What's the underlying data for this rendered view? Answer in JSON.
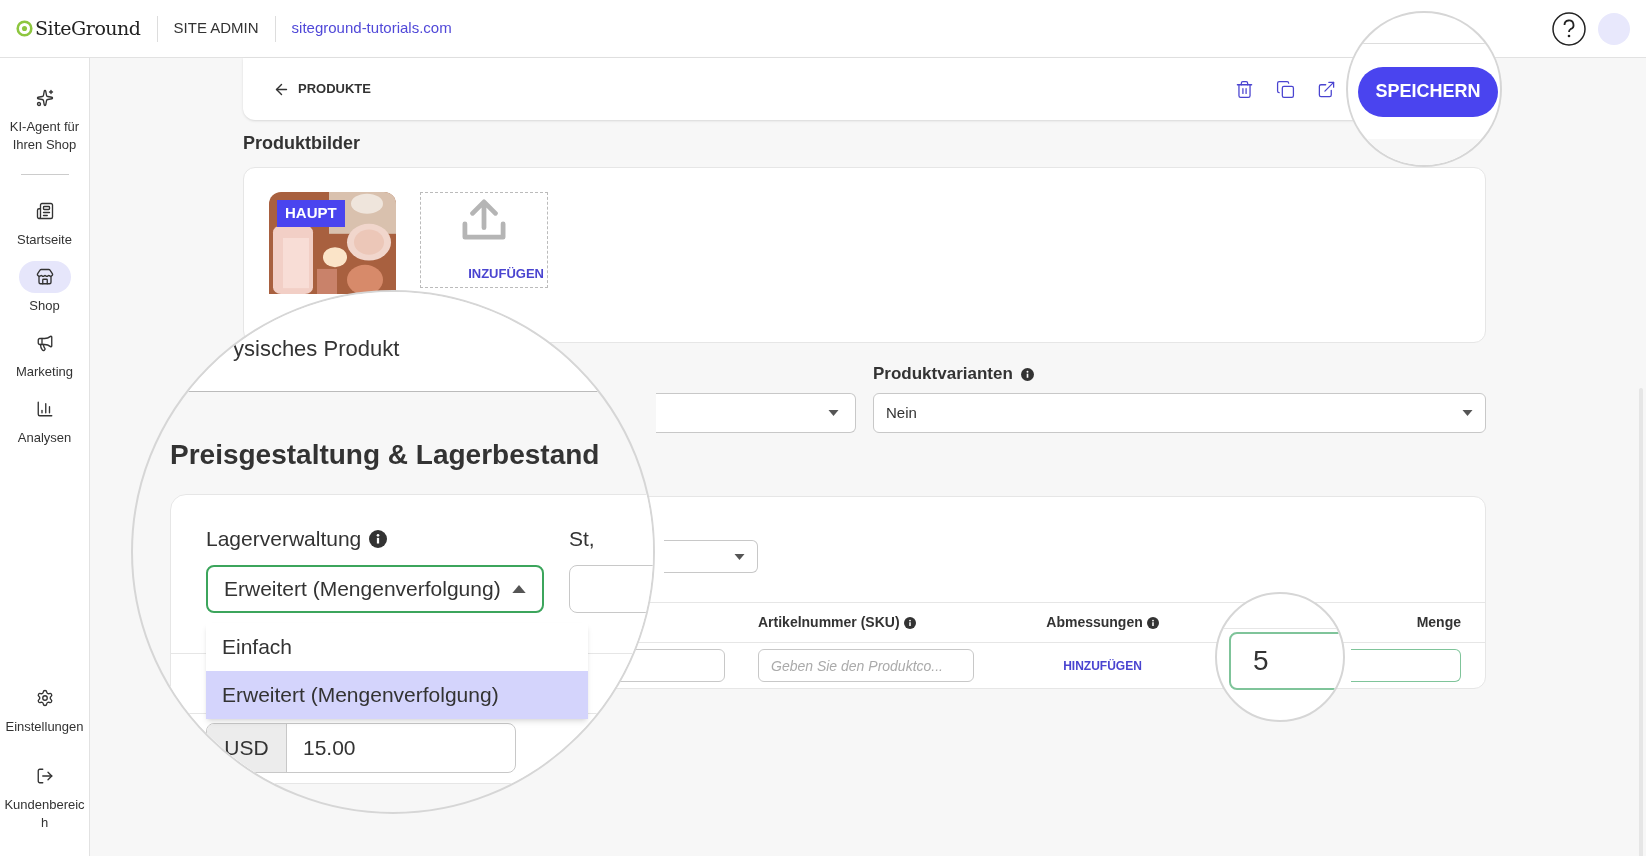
{
  "topbar": {
    "logo": "SiteGround",
    "section": "SITE ADMIN",
    "site": "siteground-tutorials.com"
  },
  "sidebar": {
    "items": [
      {
        "label": "KI-Agent für Ihren Shop",
        "selected": false
      },
      {
        "label": "Startseite",
        "selected": false
      },
      {
        "label": "Shop",
        "selected": true
      },
      {
        "label": "Marketing",
        "selected": false
      },
      {
        "label": "Analysen",
        "selected": false
      }
    ],
    "bottom_items": [
      {
        "label": "Einstellungen",
        "selected": false
      },
      {
        "label": "Kundenbereich",
        "selected": false
      }
    ]
  },
  "header": {
    "back": "PRODUKTE",
    "save": "SPEICHERN"
  },
  "images": {
    "title": "Produktbilder",
    "main_badge": "HAUPT",
    "upload": "INZUFÜGEN"
  },
  "variants": {
    "label": "Produktvarianten",
    "value": "Nein"
  },
  "magnifier": {
    "product_type": "ysisches Produkt",
    "section_title": "Preisgestaltung & Lagerbestand",
    "inventory": {
      "label": "Lagerverwaltung",
      "value": "Erweitert (Mengenverfolgung)",
      "expanded": true,
      "options": [
        {
          "label": "Einfach",
          "selected": false
        },
        {
          "label": "Erweitert (Mengenverfolgung)",
          "selected": true
        }
      ]
    },
    "status_label": "St,",
    "currency": "USD",
    "price": "15.00"
  },
  "table": {
    "columns": [
      "Artikelnummer (SKU)",
      "Abmessungen",
      "Menge"
    ],
    "row": {
      "sku_placeholder": "Geben Sie den Produktco...",
      "dimensions_link": "HINZUFÜGEN",
      "quantity": "5"
    }
  }
}
